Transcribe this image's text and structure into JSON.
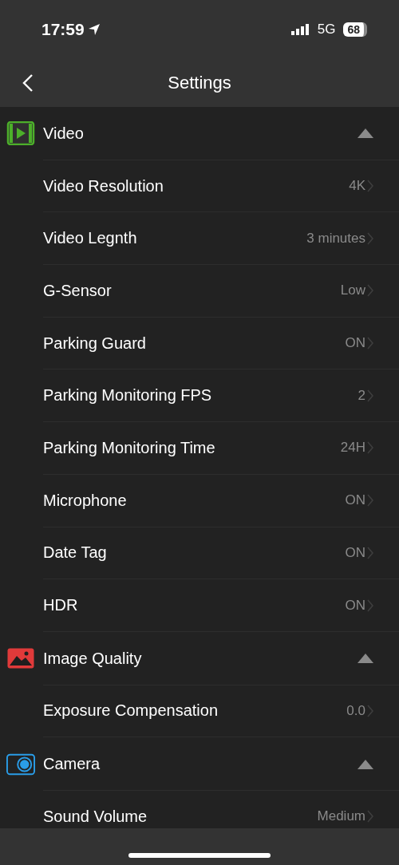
{
  "status_bar": {
    "time": "17:59",
    "network": "5G",
    "battery": "68"
  },
  "nav": {
    "title": "Settings"
  },
  "sections": [
    {
      "title": "Video",
      "kind": "video",
      "expanded": true,
      "items": [
        {
          "label": "Video Resolution",
          "value": "4K"
        },
        {
          "label": "Video Legnth",
          "value": "3 minutes"
        },
        {
          "label": "G-Sensor",
          "value": "Low"
        },
        {
          "label": "Parking Guard",
          "value": "ON"
        },
        {
          "label": "Parking Monitoring FPS",
          "value": "2"
        },
        {
          "label": "Parking Monitoring Time",
          "value": "24H"
        },
        {
          "label": "Microphone",
          "value": "ON"
        },
        {
          "label": "Date Tag",
          "value": "ON"
        },
        {
          "label": "HDR",
          "value": "ON"
        }
      ]
    },
    {
      "title": "Image Quality",
      "kind": "image",
      "expanded": true,
      "items": [
        {
          "label": "Exposure Compensation",
          "value": "0.0"
        }
      ]
    },
    {
      "title": "Camera",
      "kind": "camera",
      "expanded": true,
      "items": [
        {
          "label": "Sound Volume",
          "value": "Medium"
        }
      ]
    }
  ]
}
